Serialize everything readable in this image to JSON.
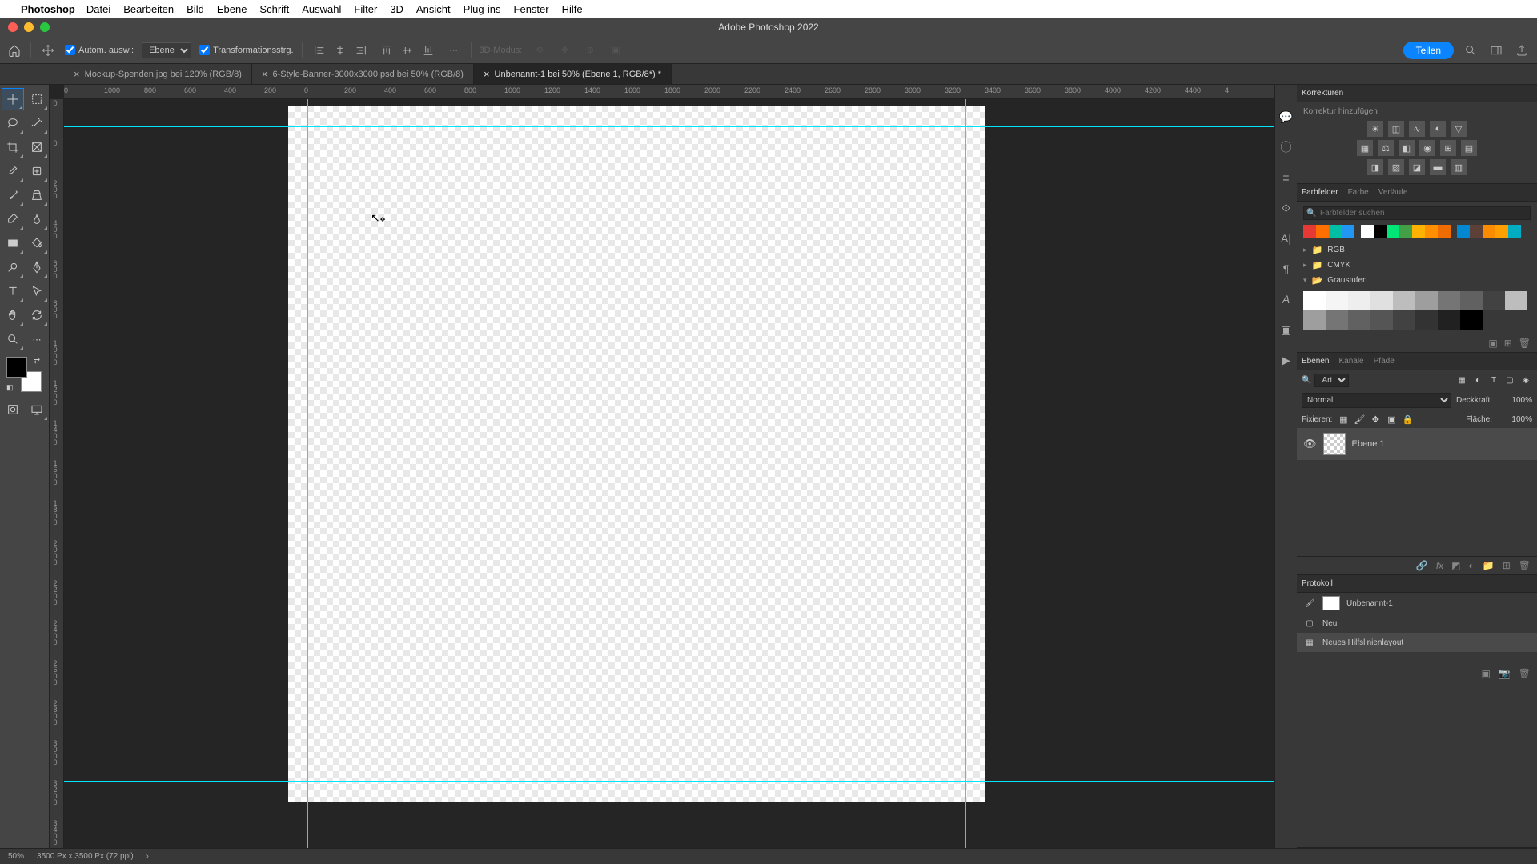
{
  "mac_menu": {
    "app": "Photoshop",
    "items": [
      "Datei",
      "Bearbeiten",
      "Bild",
      "Ebene",
      "Schrift",
      "Auswahl",
      "Filter",
      "3D",
      "Ansicht",
      "Plug-ins",
      "Fenster",
      "Hilfe"
    ]
  },
  "app_title": "Adobe Photoshop 2022",
  "options_bar": {
    "auto_select_label": "Autom. ausw.:",
    "auto_select_value": "Ebene",
    "transform_label": "Transformationsstrg.",
    "mode3d_label": "3D-Modus:",
    "share_label": "Teilen"
  },
  "doc_tabs": [
    {
      "label": "Mockup-Spenden.jpg bei 120% (RGB/8)",
      "active": false
    },
    {
      "label": "6-Style-Banner-3000x3000.psd bei 50% (RGB/8)",
      "active": false
    },
    {
      "label": "Unbenannt-1 bei 50% (Ebene 1, RGB/8*) *",
      "active": true
    }
  ],
  "ruler_h": [
    "0",
    "1000",
    "800",
    "600",
    "400",
    "200",
    "0",
    "200",
    "400",
    "600",
    "800",
    "1000",
    "1200",
    "1400",
    "1600",
    "1800",
    "2000",
    "2200",
    "2400",
    "2600",
    "2800",
    "3000",
    "3200",
    "3400",
    "3600",
    "3800",
    "4000",
    "4200",
    "4400",
    "4"
  ],
  "ruler_v": [
    "0",
    "0",
    "200",
    "400",
    "600",
    "800",
    "1000",
    "1200",
    "1400",
    "1600",
    "1800",
    "2000",
    "2200",
    "2400",
    "2600",
    "2800",
    "3000",
    "3200",
    "3400"
  ],
  "panels": {
    "korrekturen": {
      "title": "Korrekturen",
      "add_label": "Korrektur hinzufügen"
    },
    "swatches": {
      "tabs": [
        "Farbfelder",
        "Farbe",
        "Verläufe"
      ],
      "search_placeholder": "Farbfelder suchen",
      "groups": [
        {
          "name": "RGB",
          "open": false
        },
        {
          "name": "CMYK",
          "open": false
        },
        {
          "name": "Graustufen",
          "open": true
        }
      ],
      "top_colors": [
        "#e53935",
        "#ff6f00",
        "#00bfa5",
        "#2196f3"
      ],
      "top_colors2": [
        "#ffffff",
        "#000000",
        "#00e676",
        "#43a047",
        "#ffb300",
        "#ff8f00",
        "#ef6c00"
      ],
      "top_colors3": [
        "#0288d1",
        "#5d4037",
        "#fb8c00",
        "#ffa000",
        "#00acc1"
      ],
      "grays": [
        "#ffffff",
        "#f5f5f5",
        "#eeeeee",
        "#e0e0e0",
        "#bdbdbd",
        "#9e9e9e",
        "#757575",
        "#616161",
        "#424242",
        "#bdbdbd",
        "#9e9e9e",
        "#757575",
        "#616161",
        "#555555",
        "#424242",
        "#333333",
        "#212121",
        "#000000"
      ]
    },
    "layers": {
      "tabs": [
        "Ebenen",
        "Kanäle",
        "Pfade"
      ],
      "filter_label": "Art",
      "blend_mode": "Normal",
      "opacity_label": "Deckkraft:",
      "opacity_value": "100%",
      "lock_label": "Fixieren:",
      "fill_label": "Fläche:",
      "fill_value": "100%",
      "layer_name": "Ebene 1"
    },
    "history": {
      "title": "Protokoll",
      "doc_name": "Unbenannt-1",
      "items": [
        "Neu",
        "Neues Hilfslinienlayout"
      ]
    }
  },
  "status": {
    "zoom": "50%",
    "info": "3500 Px x 3500 Px (72 ppi)"
  }
}
